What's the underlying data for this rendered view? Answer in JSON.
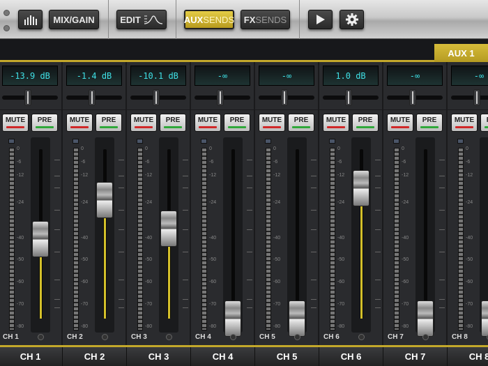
{
  "toolbar": {
    "mix_gain": "MIX/GAIN",
    "edit": "EDIT",
    "aux_a": "AUX",
    "aux_b": "SENDS",
    "fx_a": "FX",
    "fx_b": "SENDS"
  },
  "aux_tab": "AUX 1",
  "buttons": {
    "mute": "MUTE",
    "pre": "PRE"
  },
  "scale": [
    "0",
    "-6",
    "-12",
    "-24",
    "-40",
    "-50",
    "-60",
    "-70",
    "-80"
  ],
  "channels": [
    {
      "name": "CH 1",
      "value": "-13.9 dB",
      "fader": 0.47
    },
    {
      "name": "CH 2",
      "value": "-1.4 dB",
      "fader": 0.7
    },
    {
      "name": "CH 3",
      "value": "-10.1 dB",
      "fader": 0.53
    },
    {
      "name": "CH 4",
      "value": "-∞",
      "fader": 0
    },
    {
      "name": "CH 5",
      "value": "-∞",
      "fader": 0
    },
    {
      "name": "CH 6",
      "value": "1.0 dB",
      "fader": 0.77
    },
    {
      "name": "CH 7",
      "value": "-∞",
      "fader": 0
    },
    {
      "name": "CH 8",
      "value": "-∞",
      "fader": 0
    }
  ],
  "colors": {
    "accent": "#c3a82b",
    "display": "#3fe0e6",
    "mute": "#d02828",
    "pre": "#2fa83a"
  }
}
